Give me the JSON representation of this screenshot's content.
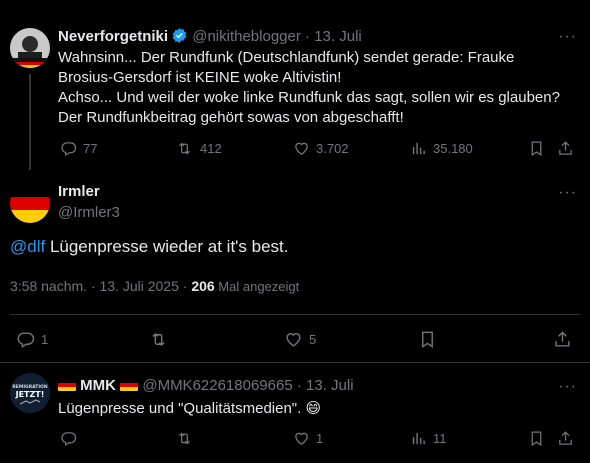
{
  "tweet1": {
    "display_name": "Neverforgetniki",
    "handle": "@nikitheblogger",
    "date": "13. Juli",
    "text_lines": [
      "Wahnsinn... Der Rundfunk (Deutschlandfunk) sendet gerade: Frauke",
      "Brosius-Gersdorf ist KEINE woke Altivistin!",
      "Achso... Und weil der woke linke Rundfunk das sagt, sollen wir es glauben?",
      "Der Rundfunkbeitrag gehört sowas von abgeschafft!"
    ],
    "replies": "77",
    "reposts": "412",
    "likes": "3.702",
    "views": "35.180"
  },
  "main_tweet": {
    "display_name": "Irmler",
    "handle": "@Irmler3",
    "mention": "@dlf",
    "text": " Lügenpresse wieder at it's best.",
    "time": "3:58 nachm. · 13. Juli 2025 · ",
    "views_count": "206",
    "views_label": " Mal angezeigt",
    "replies": "1",
    "likes": "5"
  },
  "reply": {
    "display_name": "MMK",
    "handle": "@MMK622618069665",
    "date": "13. Juli",
    "text": "Lügenpresse und \"Qualitätsmedien\". 😄",
    "likes": "1",
    "views": "11",
    "avatar_text_line1": "REMIGRATION",
    "avatar_text_line2": "JETZT!"
  },
  "colors": {
    "background": "#000000",
    "text": "#e7e9ea",
    "muted": "#71767b",
    "accent": "#1d9bf0",
    "divider": "#2f3336"
  }
}
